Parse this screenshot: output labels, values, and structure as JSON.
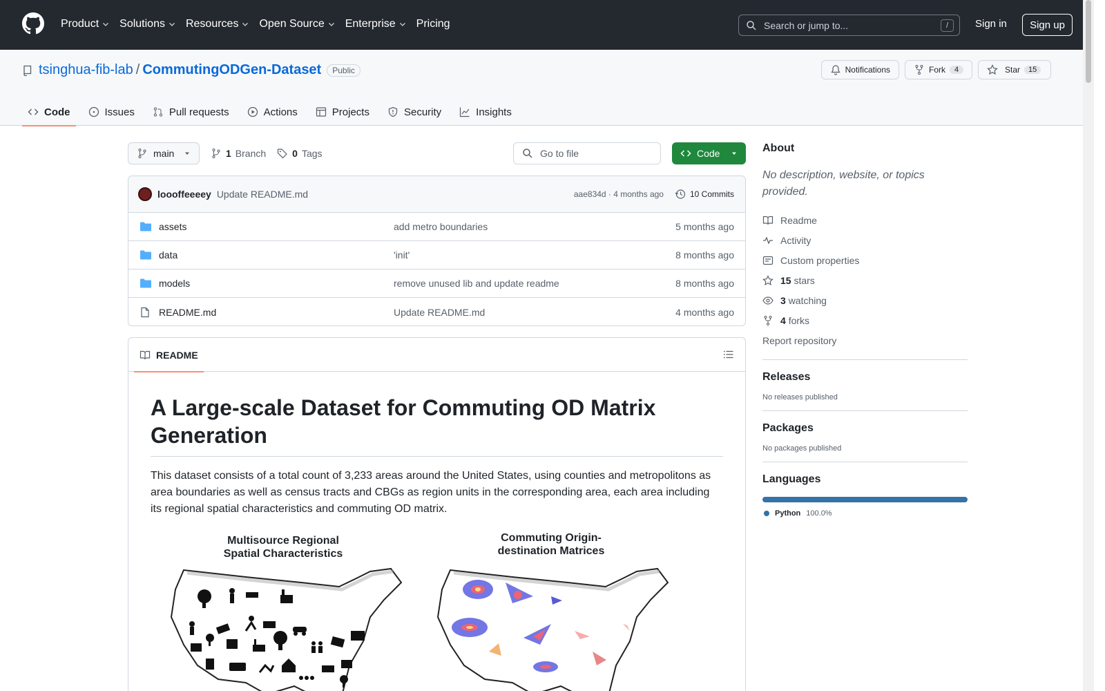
{
  "header": {
    "nav": [
      "Product",
      "Solutions",
      "Resources",
      "Open Source",
      "Enterprise",
      "Pricing"
    ],
    "search_placeholder": "Search or jump to...",
    "search_shortcut": "/",
    "sign_in": "Sign in",
    "sign_up": "Sign up"
  },
  "repo": {
    "owner": "tsinghua-fib-lab",
    "separator": "/",
    "name": "CommutingODGen-Dataset",
    "visibility": "Public",
    "notifications_label": "Notifications",
    "fork_label": "Fork",
    "fork_count": "4",
    "star_label": "Star",
    "star_count": "15"
  },
  "tabs": [
    "Code",
    "Issues",
    "Pull requests",
    "Actions",
    "Projects",
    "Security",
    "Insights"
  ],
  "branch": {
    "name": "main",
    "branch_count": "1",
    "branch_label": "Branch",
    "tag_count": "0",
    "tag_label": "Tags",
    "goto_file": "Go to file",
    "code_button": "Code"
  },
  "commit": {
    "author": "loooffeeeey",
    "message": "Update README.md",
    "hash_time": "aae834d · 4 months ago",
    "commits_label": "10 Commits"
  },
  "files": [
    {
      "type": "folder",
      "name": "assets",
      "commit": "add metro boundaries",
      "time": "5 months ago"
    },
    {
      "type": "folder",
      "name": "data",
      "commit": "'init'",
      "time": "8 months ago"
    },
    {
      "type": "folder",
      "name": "models",
      "commit": "remove unused lib and update readme",
      "time": "8 months ago"
    },
    {
      "type": "file",
      "name": "README.md",
      "commit": "Update README.md",
      "time": "4 months ago"
    }
  ],
  "readme": {
    "tab_label": "README",
    "title": "A Large-scale Dataset for Commuting OD Matrix Generation",
    "paragraph": "This dataset consists of a total count of 3,233 areas around the United States, using counties and metropolitons as area boundaries as well as census tracts and CBGs as region units in the corresponding area, each area including its regional spatial characteristics and commuting OD matrix.",
    "figure_left_title_1": "Multisource Regional",
    "figure_left_title_2": "Spatial Characteristics",
    "figure_right_title_1": "Commuting Origin-",
    "figure_right_title_2": "destination Matrices"
  },
  "about": {
    "title": "About",
    "description": "No description, website, or topics provided.",
    "items": [
      {
        "icon": "book-icon",
        "count": "",
        "label": "Readme"
      },
      {
        "icon": "pulse-icon",
        "count": "",
        "label": "Activity"
      },
      {
        "icon": "note-icon",
        "count": "",
        "label": "Custom properties"
      },
      {
        "icon": "star-icon",
        "count": "15",
        "label": "stars"
      },
      {
        "icon": "eye-icon",
        "count": "3",
        "label": "watching"
      },
      {
        "icon": "fork-icon",
        "count": "4",
        "label": "forks"
      }
    ],
    "report": "Report repository"
  },
  "releases": {
    "title": "Releases",
    "text": "No releases published"
  },
  "packages": {
    "title": "Packages",
    "text": "No packages published"
  },
  "languages": {
    "title": "Languages",
    "items": [
      {
        "name": "Python",
        "percent": "100.0%",
        "color": "#3572A5"
      }
    ]
  },
  "colors": {
    "header_bg": "#24292f",
    "link": "#0969da",
    "primary_button": "#1f883d",
    "tab_underline": "#fd8c73",
    "folder": "#54aeff"
  }
}
